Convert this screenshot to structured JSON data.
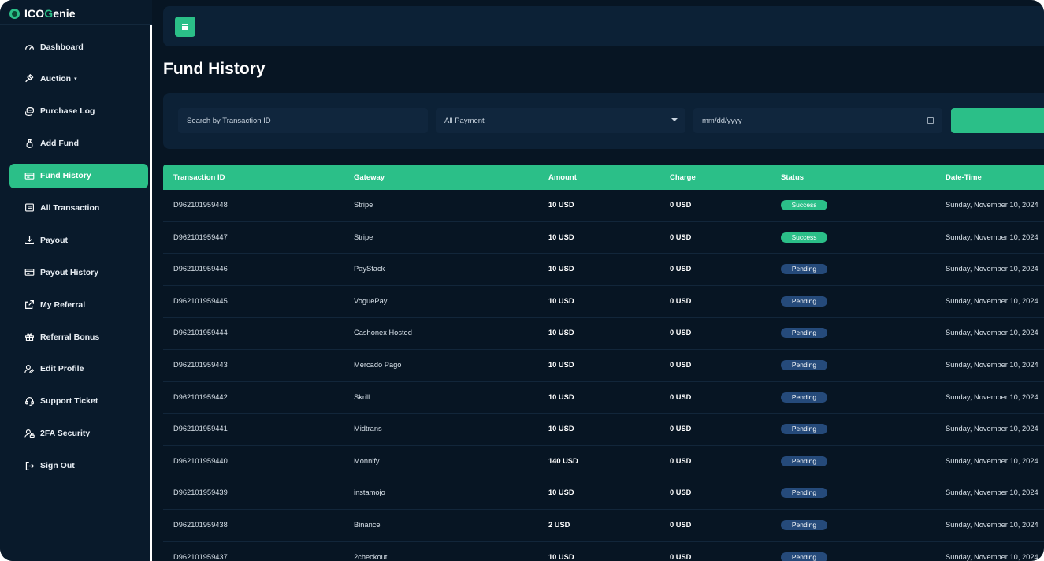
{
  "app": {
    "name_prefix": "ICO",
    "name_accent": "G",
    "name_suffix": "enie"
  },
  "sidebar": {
    "items": [
      {
        "label": "Dashboard",
        "icon": "gauge-icon",
        "name": "sidebar-item-dashboard"
      },
      {
        "label": "Auction",
        "icon": "gavel-icon",
        "name": "sidebar-item-auction",
        "caret": "▾"
      },
      {
        "label": "Purchase Log",
        "icon": "coins-icon",
        "name": "sidebar-item-purchase-log"
      },
      {
        "label": "Add Fund",
        "icon": "money-bag-icon",
        "name": "sidebar-item-add-fund"
      },
      {
        "label": "Fund History",
        "icon": "card-icon",
        "name": "sidebar-item-fund-history",
        "active": true
      },
      {
        "label": "All Transaction",
        "icon": "receipt-icon",
        "name": "sidebar-item-all-transaction"
      },
      {
        "label": "Payout",
        "icon": "download-icon",
        "name": "sidebar-item-payout"
      },
      {
        "label": "Payout History",
        "icon": "card-icon",
        "name": "sidebar-item-payout-history"
      },
      {
        "label": "My Referral",
        "icon": "share-icon",
        "name": "sidebar-item-my-referral"
      },
      {
        "label": "Referral Bonus",
        "icon": "gift-icon",
        "name": "sidebar-item-referral-bonus"
      },
      {
        "label": "Edit Profile",
        "icon": "user-edit-icon",
        "name": "sidebar-item-edit-profile"
      },
      {
        "label": "Support Ticket",
        "icon": "headset-icon",
        "name": "sidebar-item-support-ticket"
      },
      {
        "label": "2FA Security",
        "icon": "user-lock-icon",
        "name": "sidebar-item-2fa-security"
      },
      {
        "label": "Sign Out",
        "icon": "sign-out-icon",
        "name": "sidebar-item-sign-out"
      }
    ]
  },
  "page": {
    "title": "Fund History"
  },
  "filters": {
    "search_placeholder": "Search by Transaction ID",
    "payment_selected": "All Payment",
    "date_placeholder": "mm/dd/yyyy"
  },
  "table": {
    "headers": [
      "Transaction ID",
      "Gateway",
      "Amount",
      "Charge",
      "Status",
      "Date-Time"
    ],
    "rows": [
      {
        "id": "D962101959448",
        "gateway": "Stripe",
        "amount": "10 USD",
        "charge": "0 USD",
        "status": "Success",
        "date": "Sunday, November 10, 2024"
      },
      {
        "id": "D962101959447",
        "gateway": "Stripe",
        "amount": "10 USD",
        "charge": "0 USD",
        "status": "Success",
        "date": "Sunday, November 10, 2024"
      },
      {
        "id": "D962101959446",
        "gateway": "PayStack",
        "amount": "10 USD",
        "charge": "0 USD",
        "status": "Pending",
        "date": "Sunday, November 10, 2024"
      },
      {
        "id": "D962101959445",
        "gateway": "VoguePay",
        "amount": "10 USD",
        "charge": "0 USD",
        "status": "Pending",
        "date": "Sunday, November 10, 2024"
      },
      {
        "id": "D962101959444",
        "gateway": "Cashonex Hosted",
        "amount": "10 USD",
        "charge": "0 USD",
        "status": "Pending",
        "date": "Sunday, November 10, 2024"
      },
      {
        "id": "D962101959443",
        "gateway": "Mercado Pago",
        "amount": "10 USD",
        "charge": "0 USD",
        "status": "Pending",
        "date": "Sunday, November 10, 2024"
      },
      {
        "id": "D962101959442",
        "gateway": "Skrill",
        "amount": "10 USD",
        "charge": "0 USD",
        "status": "Pending",
        "date": "Sunday, November 10, 2024"
      },
      {
        "id": "D962101959441",
        "gateway": "Midtrans",
        "amount": "10 USD",
        "charge": "0 USD",
        "status": "Pending",
        "date": "Sunday, November 10, 2024"
      },
      {
        "id": "D962101959440",
        "gateway": "Monnify",
        "amount": "140 USD",
        "charge": "0 USD",
        "status": "Pending",
        "date": "Sunday, November 10, 2024"
      },
      {
        "id": "D962101959439",
        "gateway": "instamojo",
        "amount": "10 USD",
        "charge": "0 USD",
        "status": "Pending",
        "date": "Sunday, November 10, 2024"
      },
      {
        "id": "D962101959438",
        "gateway": "Binance",
        "amount": "2 USD",
        "charge": "0 USD",
        "status": "Pending",
        "date": "Sunday, November 10, 2024"
      },
      {
        "id": "D962101959437",
        "gateway": "2checkout",
        "amount": "10 USD",
        "charge": "0 USD",
        "status": "Pending",
        "date": "Sunday, November 10, 2024"
      }
    ]
  },
  "colors": {
    "accent": "#2bbf88",
    "background": "#071523",
    "pending": "#254a7a"
  }
}
